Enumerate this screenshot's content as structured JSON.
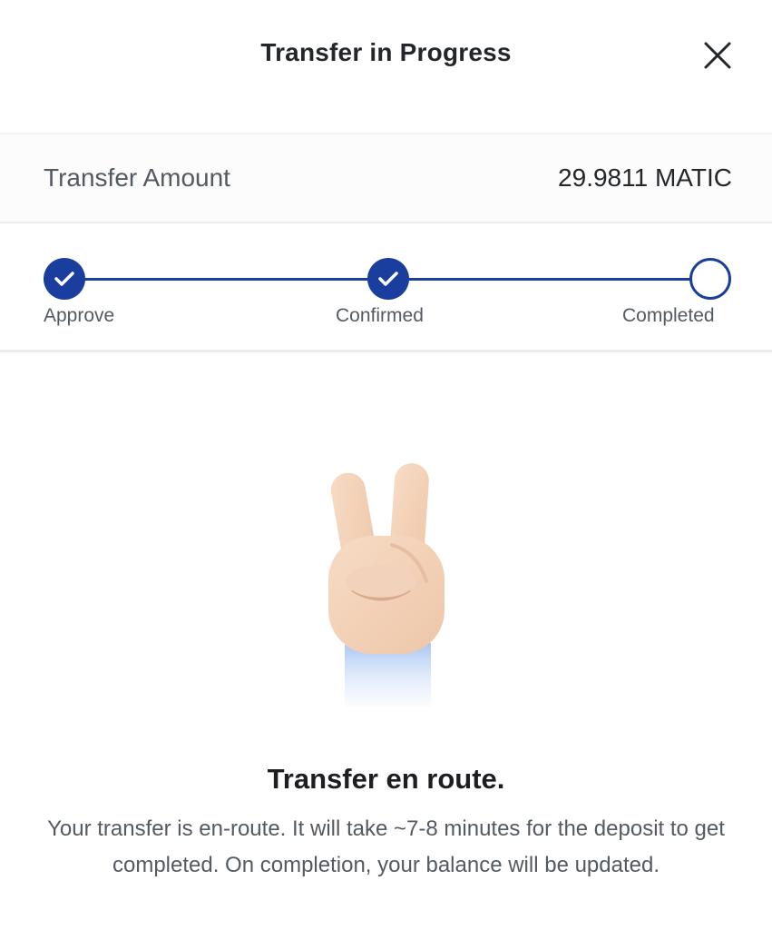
{
  "header": {
    "title": "Transfer in Progress",
    "close_icon": "close-icon"
  },
  "amount": {
    "label": "Transfer Amount",
    "value": "29.9811 MATIC"
  },
  "stepper": {
    "accent_color": "#1a3e9e",
    "steps": [
      {
        "label": "Approve",
        "status": "done",
        "icon": "check-icon"
      },
      {
        "label": "Confirmed",
        "status": "done",
        "icon": "check-icon"
      },
      {
        "label": "Completed",
        "status": "pending",
        "icon": "empty-circle-icon"
      }
    ]
  },
  "illustration": {
    "icon": "victory-hand-icon"
  },
  "message": {
    "title": "Transfer en route.",
    "body": "Your transfer is en-route. It will take ~7-8 minutes for the deposit to get completed. On completion, your balance will be updated."
  }
}
